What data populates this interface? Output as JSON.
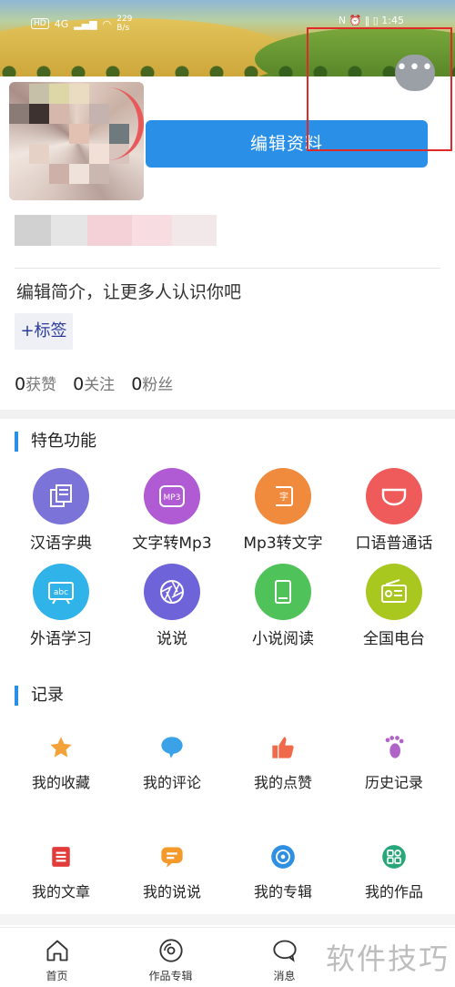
{
  "status_bar": {
    "badge": "HD",
    "network": "4G",
    "speed_value": "229",
    "speed_unit": "B/s",
    "right": "N ⏰ ‖ ▯ 1:45"
  },
  "profile": {
    "edit_button": "编辑资料",
    "more_button": "•••",
    "bio": "编辑简介，让更多人认识你吧",
    "tag_button": "+标签",
    "stats": [
      {
        "num": "0",
        "label": "获赞"
      },
      {
        "num": "0",
        "label": "关注"
      },
      {
        "num": "0",
        "label": "粉丝"
      }
    ]
  },
  "features": {
    "title": "特色功能",
    "items": [
      {
        "label": "汉语字典",
        "icon": "dictionary-icon",
        "color": "#7b73d8"
      },
      {
        "label": "文字转Mp3",
        "icon": "mp3-icon",
        "color": "#b05ad4"
      },
      {
        "label": "Mp3转文字",
        "icon": "text-convert-icon",
        "color": "#f08a3c"
      },
      {
        "label": "口语普通话",
        "icon": "mouth-icon",
        "color": "#ef5b5b"
      },
      {
        "label": "外语学习",
        "icon": "abc-board-icon",
        "color": "#2fb3e8"
      },
      {
        "label": "说说",
        "icon": "aperture-icon",
        "color": "#6f63d9"
      },
      {
        "label": "小说阅读",
        "icon": "book-icon",
        "color": "#4fc25a"
      },
      {
        "label": "全国电台",
        "icon": "radio-icon",
        "color": "#a8c71f"
      }
    ]
  },
  "records": {
    "title": "记录",
    "items": [
      {
        "label": "我的收藏",
        "icon": "star-icon",
        "color": "#f3a23a"
      },
      {
        "label": "我的评论",
        "icon": "comment-icon",
        "color": "#3ca2e8"
      },
      {
        "label": "我的点赞",
        "icon": "thumbs-up-icon",
        "color": "#f0694a"
      },
      {
        "label": "历史记录",
        "icon": "footprint-icon",
        "color": "#b062c9"
      },
      {
        "label": "我的文章",
        "icon": "article-icon",
        "color": "#e23b3b"
      },
      {
        "label": "我的说说",
        "icon": "chat-bubble-icon",
        "color": "#f39a2b"
      },
      {
        "label": "我的专辑",
        "icon": "disc-icon",
        "color": "#2f8fe0"
      },
      {
        "label": "我的作品",
        "icon": "grid-apps-icon",
        "color": "#2aa77a"
      }
    ]
  },
  "tabbar": {
    "items": [
      {
        "label": "首页",
        "icon": "home-icon"
      },
      {
        "label": "作品专辑",
        "icon": "disc-icon"
      },
      {
        "label": "消息",
        "icon": "message-icon"
      }
    ]
  },
  "watermark": "软件技巧"
}
